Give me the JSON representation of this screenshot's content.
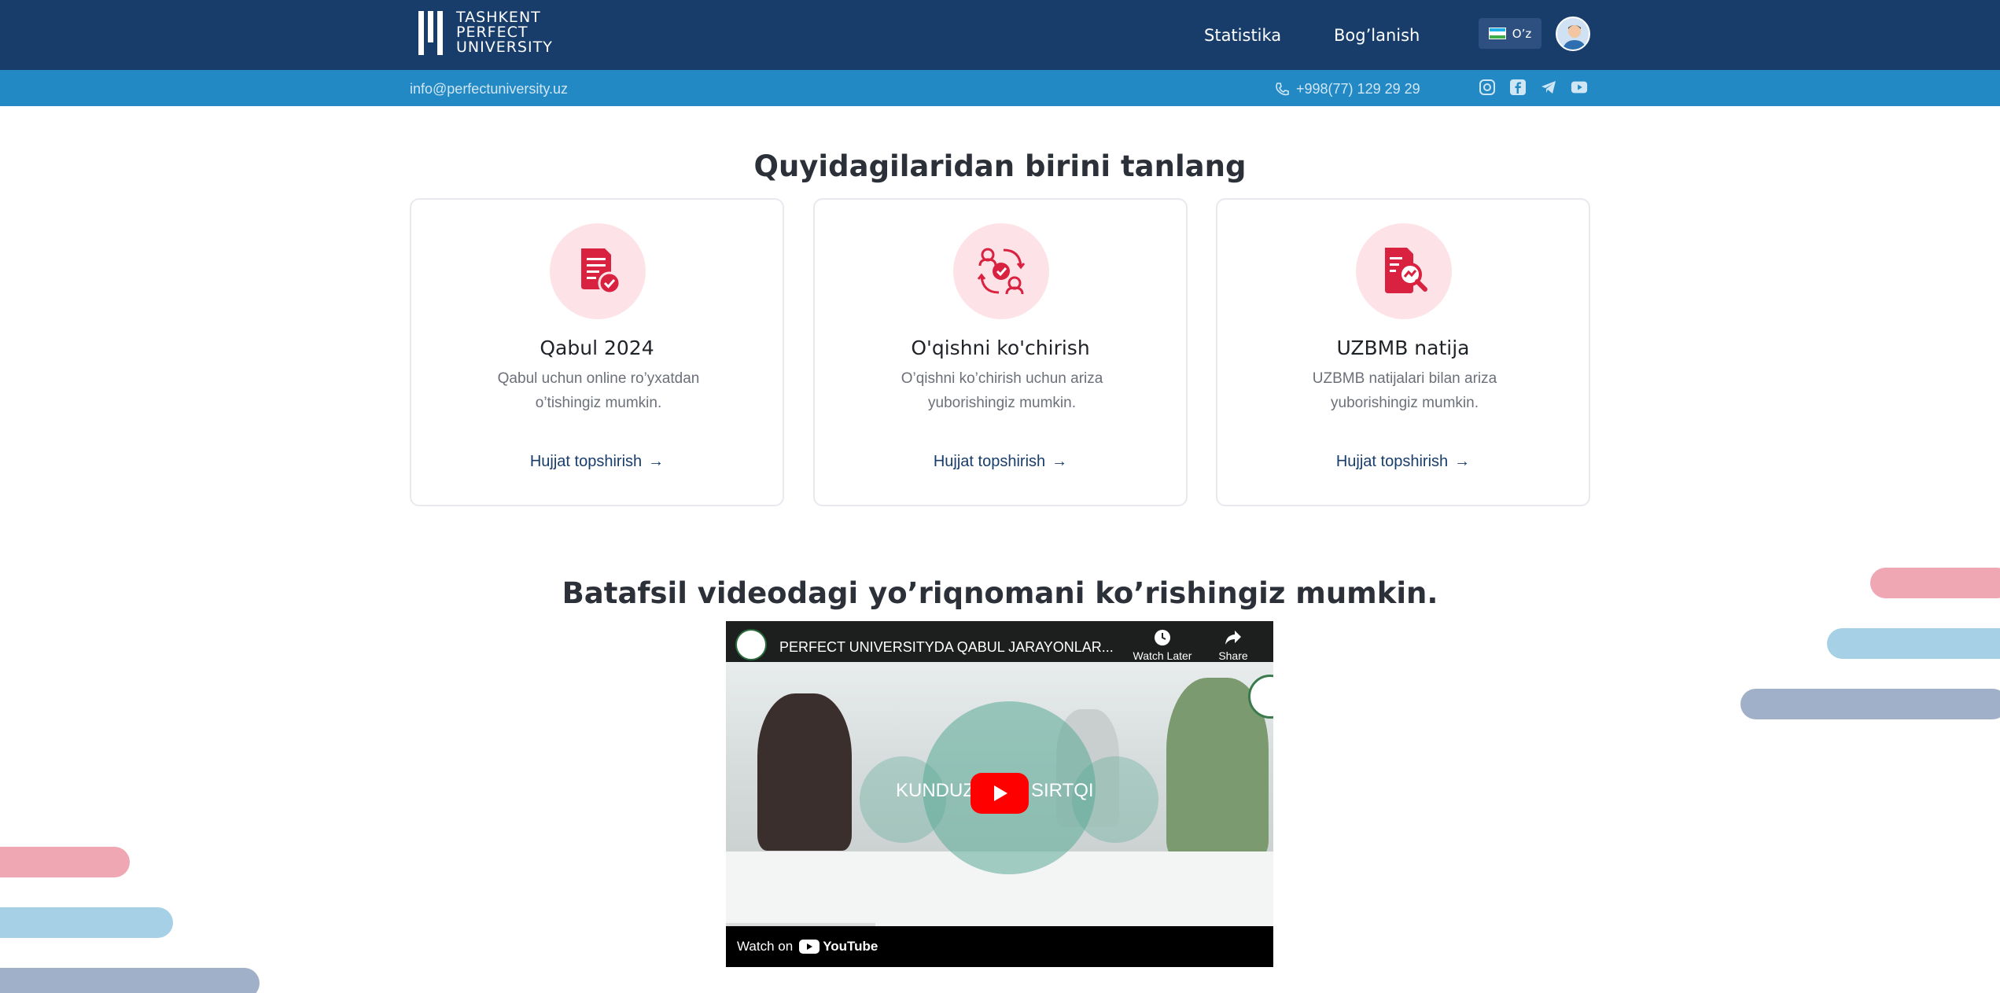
{
  "header": {
    "logo_lines": [
      "TASHKENT",
      "PERFECT",
      "UNIVERSITY"
    ],
    "nav": [
      "Statistika",
      "Bog’lanish"
    ],
    "language": "O’z",
    "avatar_icon": "user-avatar-icon"
  },
  "infobar": {
    "email": "info@perfectuniversity.uz",
    "phone": "+998(77) 129 29 29",
    "socials": [
      "instagram-icon",
      "facebook-icon",
      "telegram-icon",
      "youtube-icon"
    ]
  },
  "main": {
    "heading": "Quyidagilaridan birini tanlang",
    "cards": [
      {
        "title": "Qabul 2024",
        "description": "Qabul uchun online ro’yxatdan o’tishingiz mumkin.",
        "link": "Hujjat topshirish",
        "icon": "document-check-icon"
      },
      {
        "title": "O'qishni ko'chirish",
        "description": "O’qishni ko’chirish uchun ariza yuborishingiz mumkin.",
        "link": "Hujjat topshirish",
        "icon": "transfer-users-icon"
      },
      {
        "title": "UZBMB natija",
        "description": "UZBMB natijalari bilan ariza yuborishingiz mumkin.",
        "link": "Hujjat topshirish",
        "icon": "document-search-icon"
      }
    ],
    "video_heading": "Batafsil videodagi yo’riqnomani ko’rishingiz mumkin."
  },
  "video": {
    "title": "PERFECT UNIVERSITYDA QABUL JARAYONLAR...",
    "watch_later": "Watch Later",
    "share": "Share",
    "caption_left": "KUNDUZ",
    "caption_right": "SIRTQI",
    "watch_on": "Watch on",
    "brand": "YouTube"
  },
  "colors": {
    "header_bg": "#183d6b",
    "infobar_bg": "#2389c4",
    "accent_red": "#d9223f",
    "icon_bg": "#fde3e7",
    "stripe_pink": "#efa7b3",
    "stripe_blue": "#a6d0e6",
    "stripe_gray": "#9fb0c8"
  }
}
